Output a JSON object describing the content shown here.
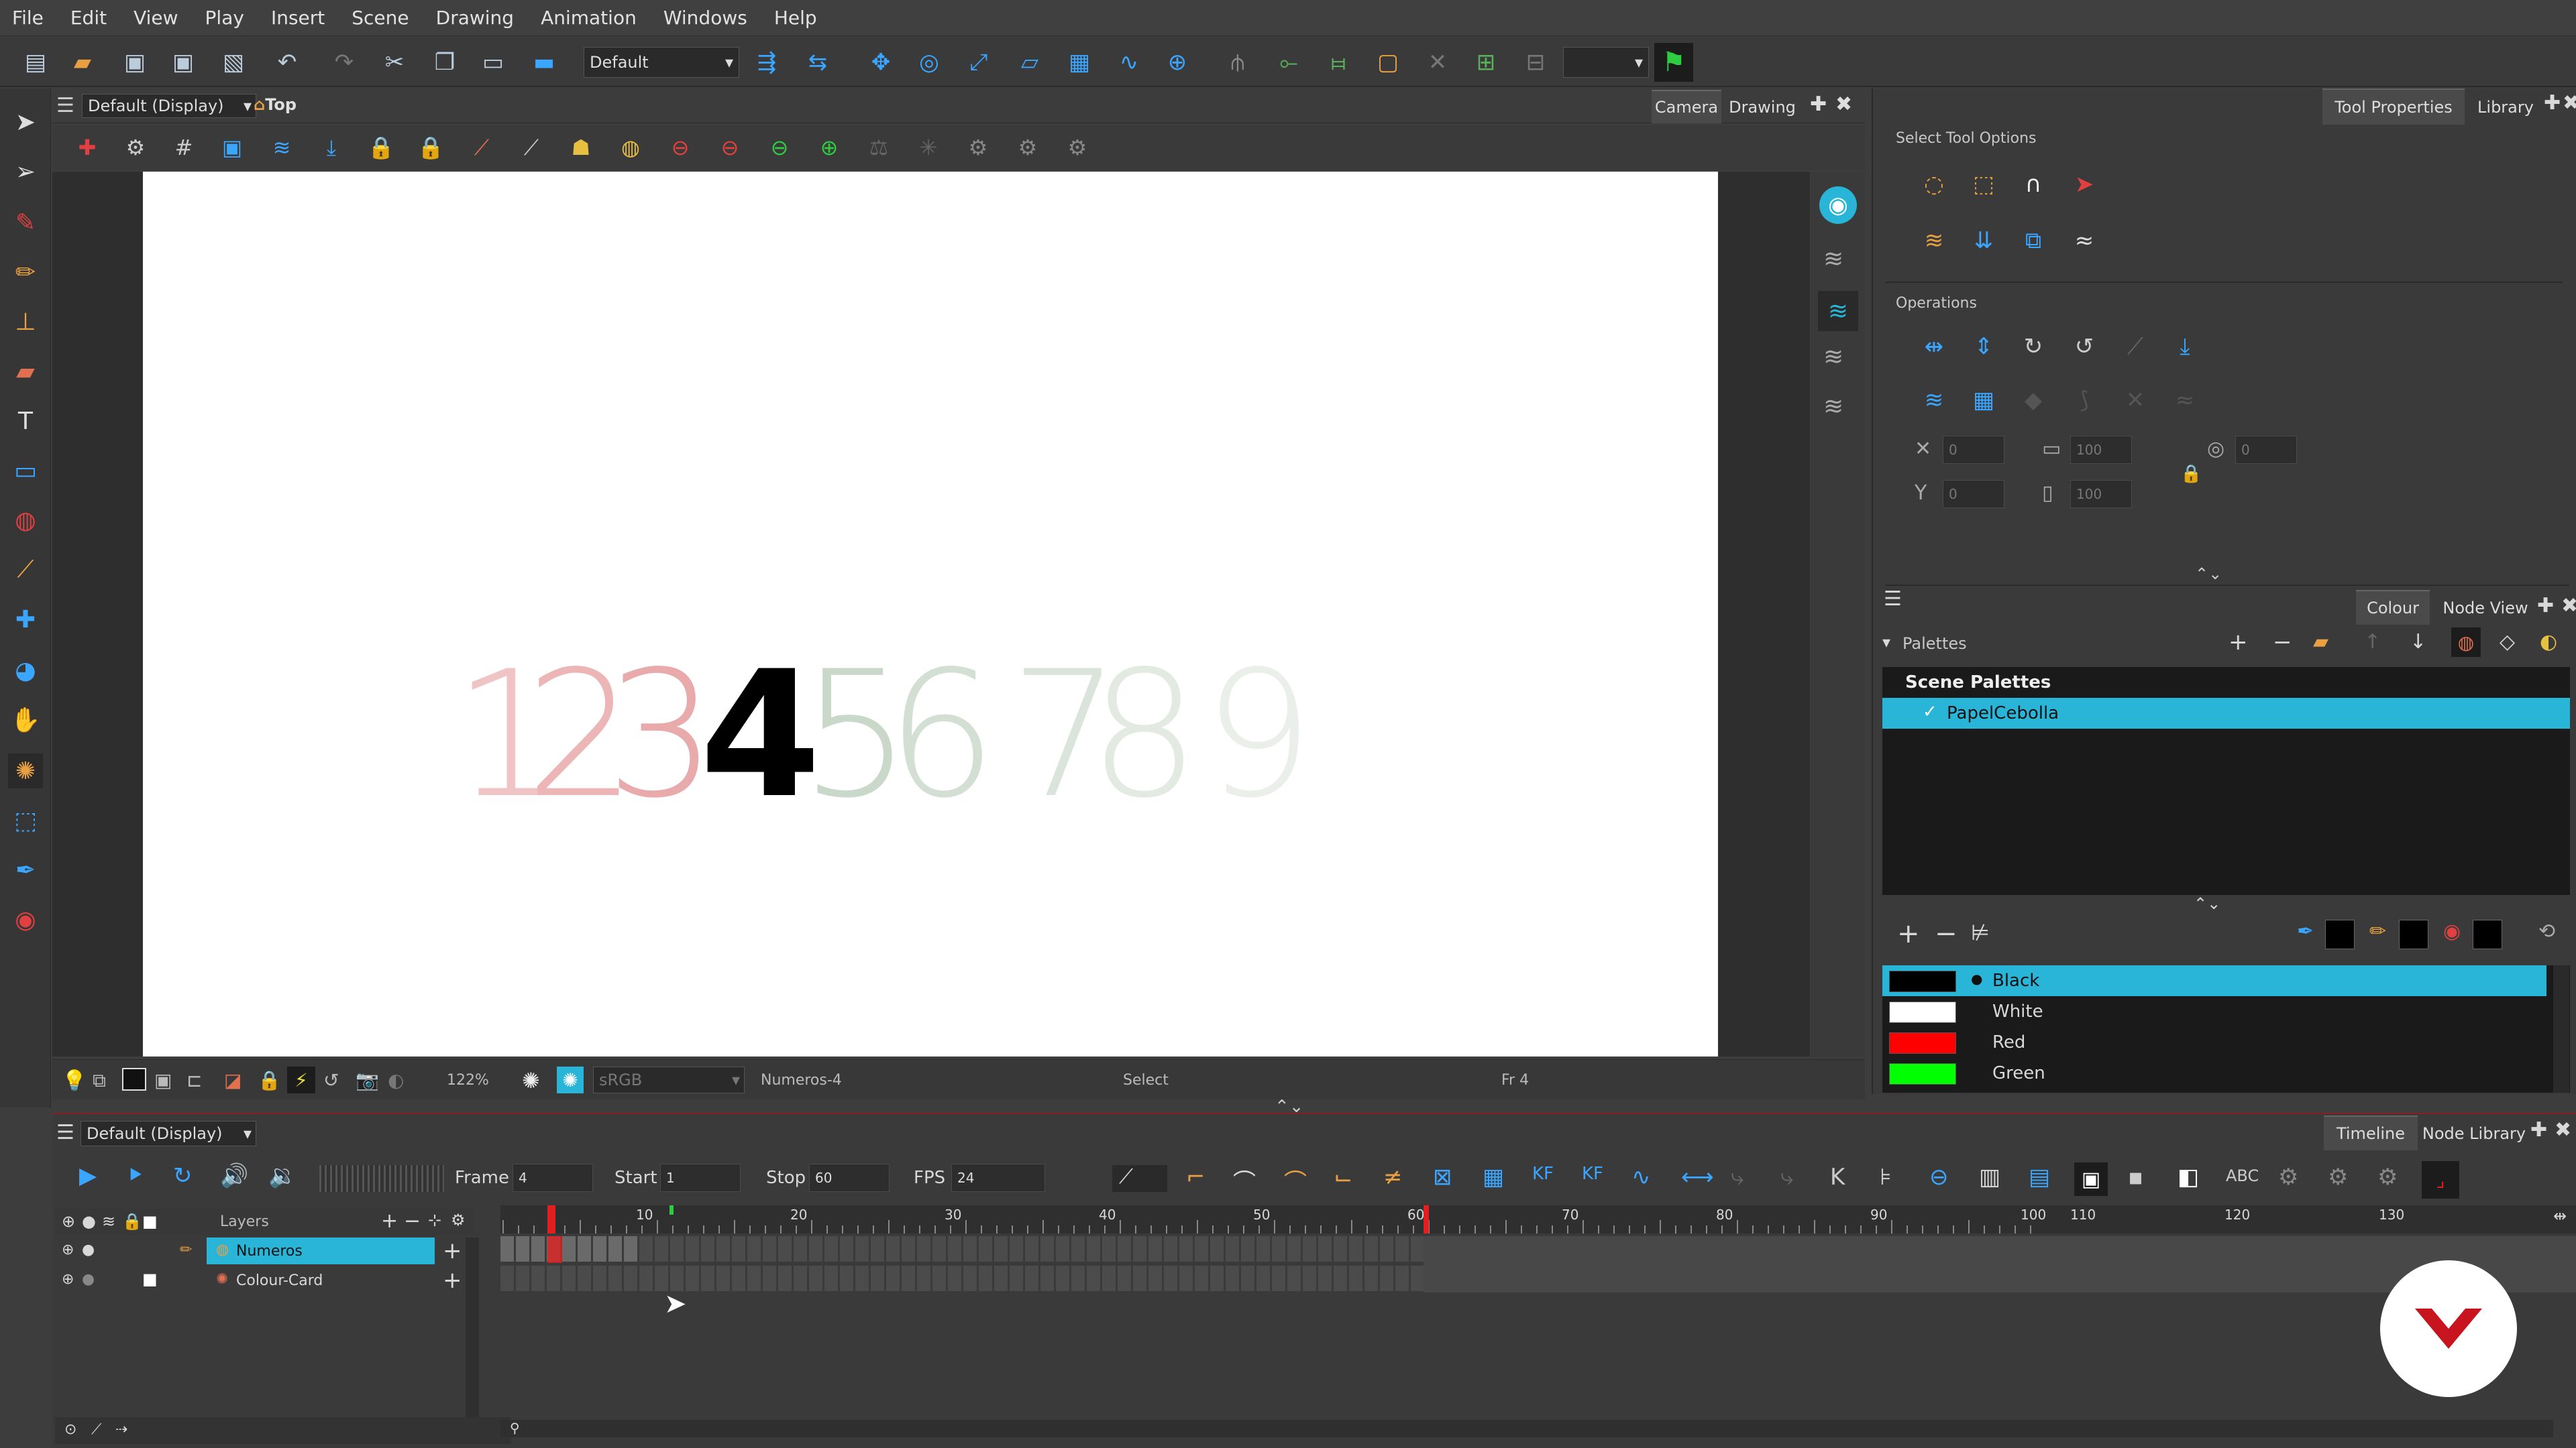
{
  "menu": [
    "File",
    "Edit",
    "View",
    "Play",
    "Insert",
    "Scene",
    "Drawing",
    "Animation",
    "Windows",
    "Help"
  ],
  "toolbar": {
    "workspace_value": "Default"
  },
  "view": {
    "display_combo": "Default (Display)",
    "view_name": "Top",
    "tabs": [
      "Camera",
      "Drawing"
    ],
    "digits": [
      {
        "char": "1",
        "color": "#f0c4c4"
      },
      {
        "char": "2",
        "color": "#ecb6b6"
      },
      {
        "char": "3",
        "color": "#e8aaaa"
      },
      {
        "char": "4",
        "color": "#000000"
      },
      {
        "char": "5",
        "color": "#c9d8c9"
      },
      {
        "char": "6",
        "color": "#d2dfd2"
      },
      {
        "char": "7",
        "color": "#dae4da"
      },
      {
        "char": "8",
        "color": "#e2eae2"
      },
      {
        "char": "9",
        "color": "#eaefea"
      }
    ],
    "status": {
      "zoom": "122%",
      "colorspace": "sRGB",
      "drawing": "Numeros-4",
      "tool": "Select",
      "frame": "Fr 4"
    }
  },
  "right_panel": {
    "tabs_top": [
      "Tool Properties",
      "Library"
    ],
    "select_tool_options": "Select Tool Options",
    "operations": "Operations",
    "fields": {
      "x": "0",
      "y": "0",
      "w": "100",
      "h": "100",
      "angle": "0"
    },
    "tabs_mid": [
      "Colour",
      "Node View"
    ],
    "palettes_label": "Palettes",
    "scene_palettes": "Scene Palettes",
    "palette_item": "PapelCebolla",
    "colours": [
      {
        "name": "Black",
        "hex": "#000000"
      },
      {
        "name": "White",
        "hex": "#ffffff"
      },
      {
        "name": "Red",
        "hex": "#ff0000"
      },
      {
        "name": "Green",
        "hex": "#00ff00"
      }
    ]
  },
  "timeline": {
    "display_combo": "Default (Display)",
    "tabs": [
      "Timeline",
      "Node Library"
    ],
    "frame_label": "Frame",
    "frame_value": "4",
    "start_label": "Start",
    "start_value": "1",
    "stop_label": "Stop",
    "stop_value": "60",
    "fps_label": "FPS",
    "fps_value": "24",
    "layers_label": "Layers",
    "layers": [
      {
        "name": "Numeros"
      },
      {
        "name": "Colour-Card"
      }
    ],
    "ruler_ticks": [
      "10",
      "20",
      "30",
      "40",
      "50",
      "60",
      "70",
      "80",
      "90",
      "100",
      "110",
      "120",
      "130"
    ]
  },
  "colors": {
    "accent": "#29b5d8",
    "playhead": "#e02020",
    "logo": "#c8141e"
  }
}
